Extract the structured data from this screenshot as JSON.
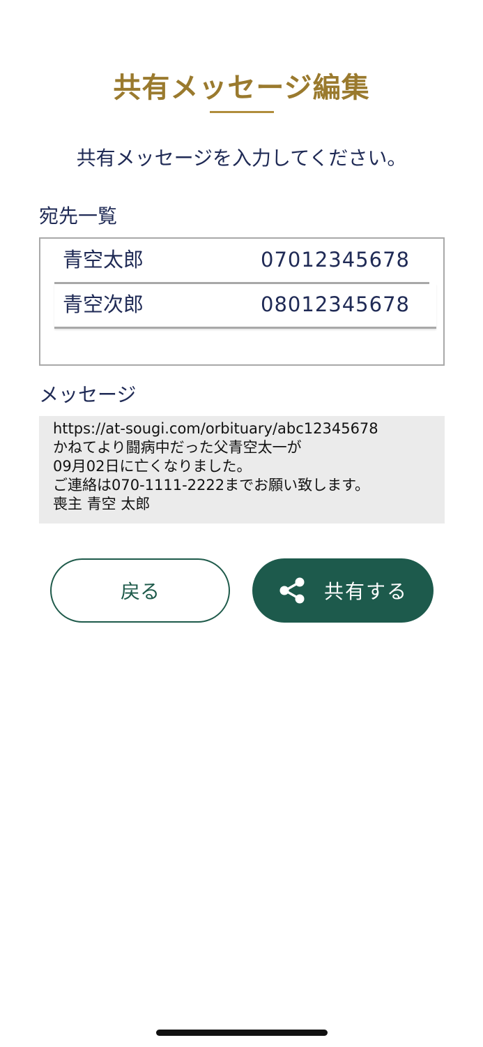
{
  "header": {
    "title": "共有メッセージ編集"
  },
  "instruction": "共有メッセージを入力してください。",
  "recipients": {
    "label": "宛先一覧",
    "items": [
      {
        "name": "青空太郎",
        "phone": "07012345678"
      },
      {
        "name": "青空次郎",
        "phone": "08012345678"
      }
    ]
  },
  "message": {
    "label": "メッセージ",
    "lines": [
      "https://at-sougi.com/orbituary/abc12345678",
      "かねてより闘病中だった父青空太一が",
      "09月02日に亡くなりました。",
      "ご連絡は070-1111-2222までお願い致します。",
      "喪主 青空 太郎"
    ]
  },
  "actions": {
    "back_label": "戻る",
    "share_label": "共有する",
    "share_icon": "share-icon"
  },
  "colors": {
    "title_gold": "#9a7a2e",
    "text_navy": "#1f2a55",
    "primary_green": "#1d5a4c"
  }
}
